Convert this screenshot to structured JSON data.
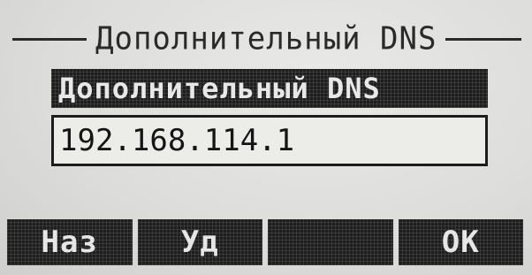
{
  "screen": {
    "title": "Дополнительный DNS"
  },
  "field": {
    "label": "Дополнительный DNS",
    "value": "192.168.114.1"
  },
  "softkeys": [
    {
      "label": "Наз"
    },
    {
      "label": "Уд"
    },
    {
      "label": ""
    },
    {
      "label": "OK"
    }
  ]
}
